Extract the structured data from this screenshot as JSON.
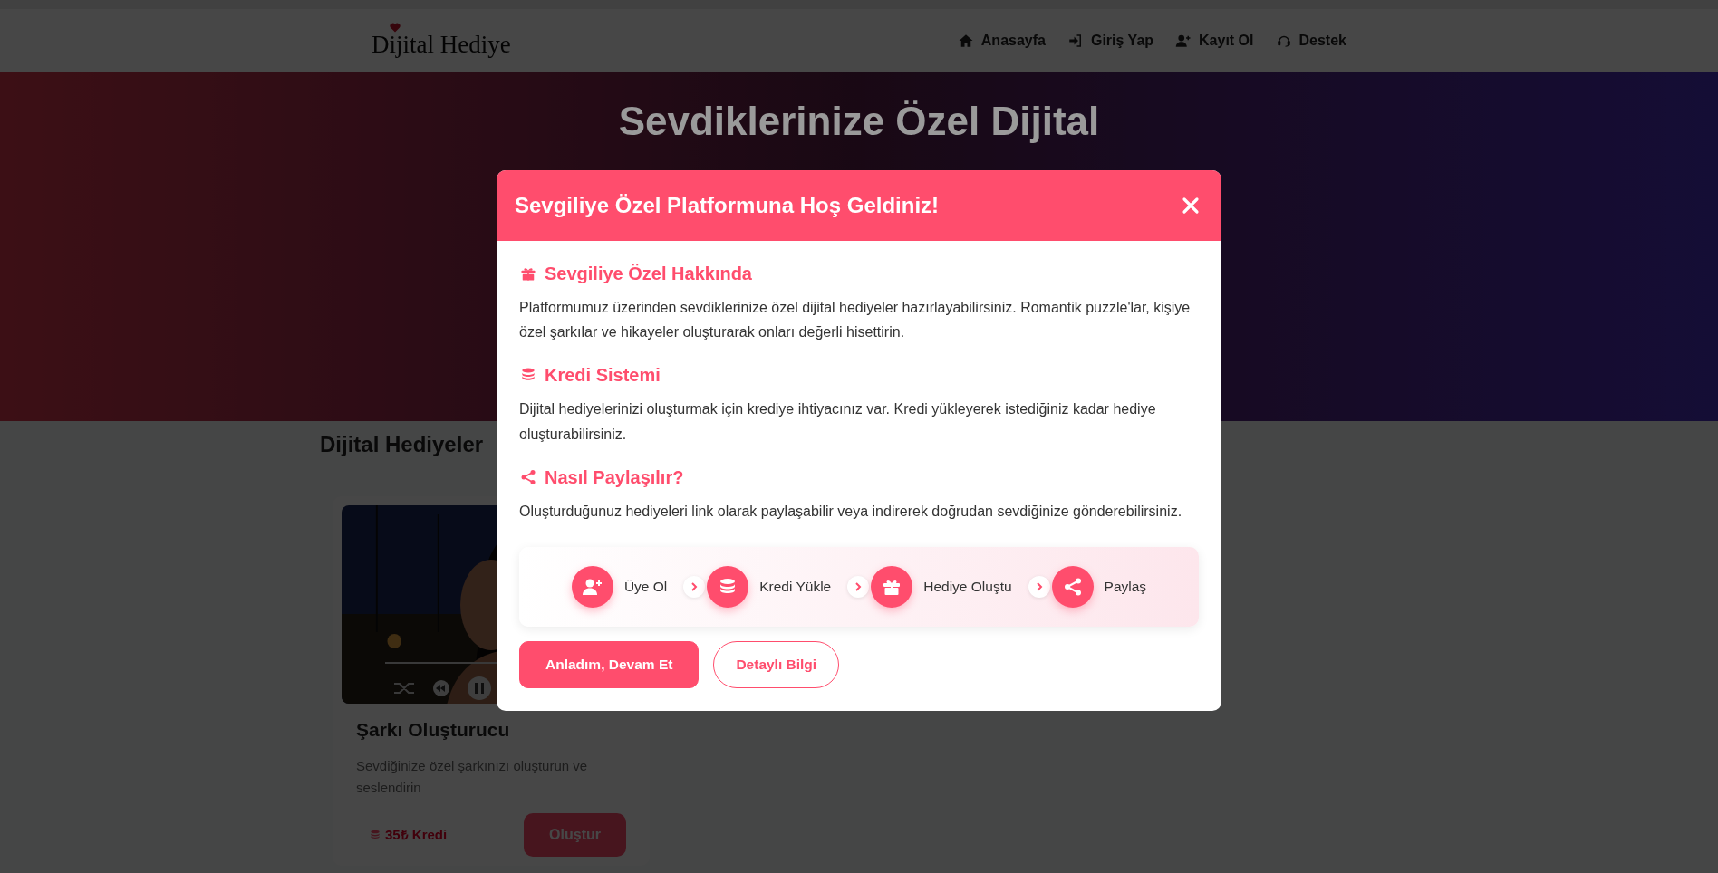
{
  "navbar": {
    "logo": "Dijital Hediye",
    "links": [
      {
        "label": "Anasayfa"
      },
      {
        "label": "Giriş Yap"
      },
      {
        "label": "Kayıt Ol"
      },
      {
        "label": "Destek"
      }
    ]
  },
  "hero": {
    "title": "Sevdiklerinize Özel Dijital"
  },
  "section": {
    "title": "Dijital Hediyeler"
  },
  "cards": [
    {
      "kind": "picture",
      "title": "Şarkı Oluşturucu",
      "description": "Sevdiğinize özel şarkınızı oluşturun ve seslendirin",
      "price": "35₺ Kredi",
      "button": "Oluştur"
    }
  ],
  "modal": {
    "title": "Sevgiliye Özel Platformuna Hoş Geldiniz!",
    "sections": [
      {
        "heading": "Sevgiliye Özel Hakkında",
        "text": "Platformumuz üzerinden sevdiklerinize özel dijital hediyeler hazırlayabilirsiniz. Romantik puzzle'lar, kişiye özel şarkılar ve hikayeler oluşturarak onları değerli hisettirin."
      },
      {
        "heading": "Kredi Sistemi",
        "text": "Dijital hediyelerinizi oluşturmak için krediye ihtiyacınız var. Kredi yükleyerek istediğiniz kadar hediye oluşturabilirsiniz."
      },
      {
        "heading": "Nasıl Paylaşılır?",
        "text": "Oluşturduğunuz hediyeleri link olarak paylaşabilir veya indirerek doğrudan sevdiğinize gönderebilirsiniz."
      }
    ],
    "steps": [
      {
        "label": "Üye Ol"
      },
      {
        "label": "Kredi Yükle"
      },
      {
        "label": "Hediye Oluştu"
      },
      {
        "label": "Paylaş"
      }
    ],
    "buttons": [
      {
        "kind": "primary",
        "label": "Anladım, Devam Et"
      },
      {
        "kind": "outline",
        "label": "Detaylı Bilgi"
      }
    ]
  }
}
